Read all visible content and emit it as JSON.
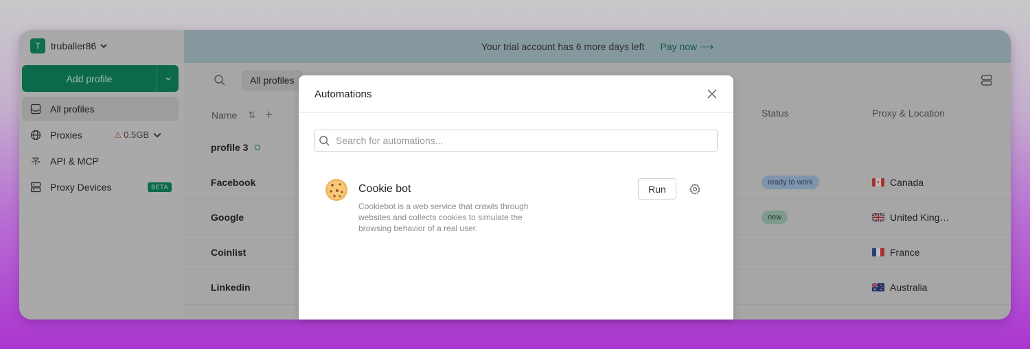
{
  "account": {
    "initial": "T",
    "name": "truballer86"
  },
  "sidebar": {
    "add_profile_label": "Add profile",
    "items": [
      {
        "label": "All profiles",
        "icon": "inbox-icon",
        "active": true
      },
      {
        "label": "Proxies",
        "icon": "globe-icon",
        "extra": "0.5GB"
      },
      {
        "label": "API & MCP",
        "icon": "api-icon"
      },
      {
        "label": "Proxy Devices",
        "icon": "devices-icon",
        "badge": "BETA"
      }
    ]
  },
  "banner": {
    "text": "Your trial account has 6 more days left",
    "pay_label": "Pay now"
  },
  "toolbar": {
    "filter_label": "All profiles"
  },
  "table": {
    "headers": {
      "name": "Name",
      "status": "Status",
      "proxy": "Proxy & Location"
    },
    "rows": [
      {
        "name": "profile 3",
        "status": "",
        "location": "",
        "online": true
      },
      {
        "name": "Facebook",
        "status": "ready to work",
        "location": "Canada",
        "flag": "ca"
      },
      {
        "name": "Google",
        "status": "new",
        "location": "United King…",
        "flag": "gb"
      },
      {
        "name": "Coinlist",
        "status": "",
        "location": "France",
        "flag": "fr"
      },
      {
        "name": "Linkedin",
        "status": "",
        "location": "Australia",
        "flag": "au"
      }
    ]
  },
  "modal": {
    "title": "Automations",
    "search_placeholder": "Search for automations...",
    "automation": {
      "name": "Cookie bot",
      "description": "Cookiebot is a web service that crawls through websites and collects cookies to simulate the browsing behavior of a real user.",
      "run_label": "Run",
      "icon": "cookie-icon"
    }
  },
  "colors": {
    "brand_green": "#0c6a4a",
    "overlay": "#a6a6a6",
    "status_blue": "#7f94ad",
    "status_green": "#7e9a8c"
  }
}
